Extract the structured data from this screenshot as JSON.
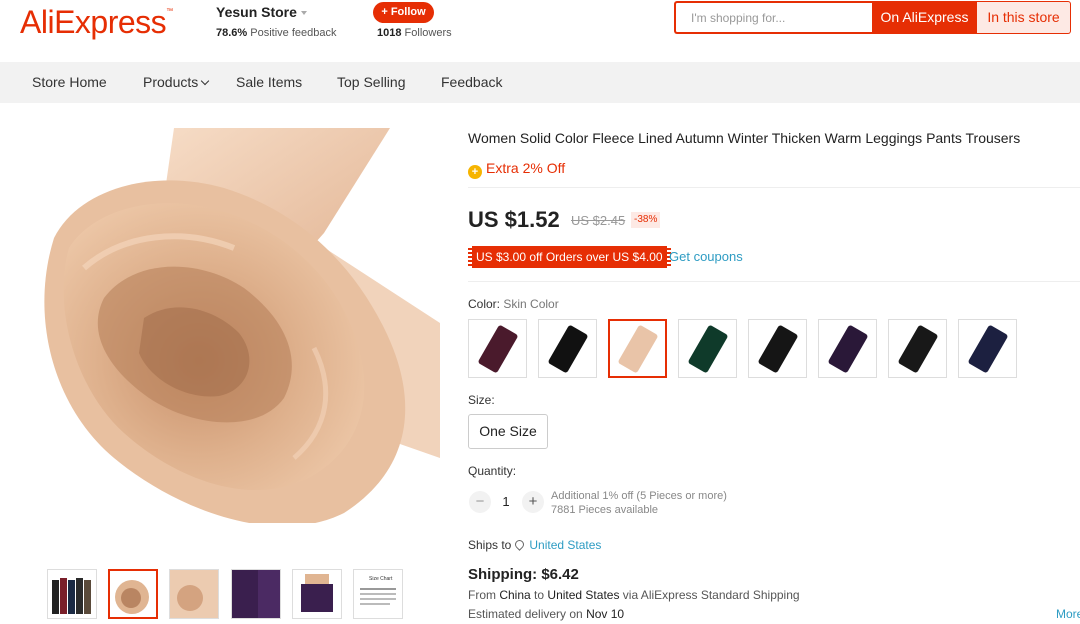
{
  "header": {
    "logo": "AliExpress",
    "logo_tm": "™",
    "store_name": "Yesun Store",
    "positive_pct": "78.6%",
    "positive_text": "Positive feedback",
    "follow_label": "+ Follow",
    "followers_count": "1018",
    "followers_text": "Followers",
    "search_placeholder": "I'm shopping for...",
    "search_on_ali": "On AliExpress",
    "search_in_store": "In this store"
  },
  "nav": {
    "items": [
      "Store Home",
      "Products",
      "Sale Items",
      "Top Selling",
      "Feedback"
    ]
  },
  "product": {
    "title": "Women Solid Color Fleece Lined Autumn Winter Thicken Warm Leggings Pants Trousers",
    "extra_off": "Extra 2% Off",
    "price": "US $1.52",
    "old_price": "US $2.45",
    "discount": "-38%",
    "coupon": "US $3.00 off Orders over US $4.00",
    "get_coupons": "Get coupons",
    "color_label": "Color:",
    "color_value": "Skin Color",
    "swatch_colors": [
      "#4a1a2c",
      "#111111",
      "#e9c4a8",
      "#0f3a2a",
      "#151515",
      "#2a1838",
      "#181818",
      "#1c2040"
    ],
    "selected_swatch": 2,
    "size_label": "Size:",
    "size_value": "One Size",
    "quantity_label": "Quantity:",
    "quantity_minus": "−",
    "quantity_value": "1",
    "quantity_plus": "+",
    "quantity_discount": "Additional 1% off (5 Pieces or more)",
    "pieces_available": "7881 Pieces available",
    "ships_to_label": "Ships to",
    "ships_to_country": "United States",
    "shipping_cost": "Shipping: $6.42",
    "ship_from_prefix": "From",
    "ship_from_country": "China",
    "ship_from_to": "to",
    "ship_to_country": "United States",
    "ship_method": "via AliExpress Standard Shipping",
    "delivery_prefix": "Estimated delivery on",
    "delivery_date": "Nov 10",
    "more": "More"
  },
  "gallery": {
    "selected_thumb": 1,
    "thumb_count": 6,
    "size_chart_title": "Size Chart"
  },
  "colors": {
    "accent": "#e62e04",
    "link": "#2e9cc3",
    "skin": "#e4b896"
  }
}
